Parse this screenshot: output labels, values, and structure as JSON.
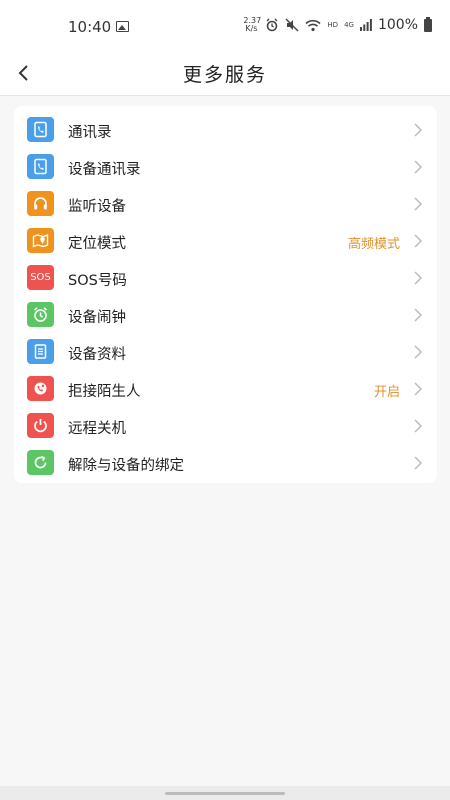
{
  "status": {
    "time": "10:40",
    "net_speed_top": "2.37",
    "net_speed_bottom": "K/s",
    "hd": "HD",
    "network": "4G",
    "battery": "100%"
  },
  "header": {
    "title": "更多服务"
  },
  "menu": [
    {
      "label": "通讯录",
      "value": "",
      "icon": "contacts-icon",
      "color": "#4a9fe8"
    },
    {
      "label": "设备通讯录",
      "value": "",
      "icon": "device-contacts-icon",
      "color": "#4a9fe8"
    },
    {
      "label": "监听设备",
      "value": "",
      "icon": "headphones-icon",
      "color": "#f0921e"
    },
    {
      "label": "定位模式",
      "value": "高频模式",
      "icon": "location-map-icon",
      "color": "#f0921e"
    },
    {
      "label": "SOS号码",
      "value": "",
      "icon": "sos-icon",
      "color": "#ef5350",
      "icon_text": "SOS"
    },
    {
      "label": "设备闹钟",
      "value": "",
      "icon": "alarm-clock-icon",
      "color": "#5cc665"
    },
    {
      "label": "设备资料",
      "value": "",
      "icon": "document-icon",
      "color": "#4a9fe8"
    },
    {
      "label": "拒接陌生人",
      "value": "开启",
      "icon": "reject-call-icon",
      "color": "#ef5350"
    },
    {
      "label": "远程关机",
      "value": "",
      "icon": "power-icon",
      "color": "#ef5350"
    },
    {
      "label": "解除与设备的绑定",
      "value": "",
      "icon": "unbind-refresh-icon",
      "color": "#5cc665"
    }
  ]
}
